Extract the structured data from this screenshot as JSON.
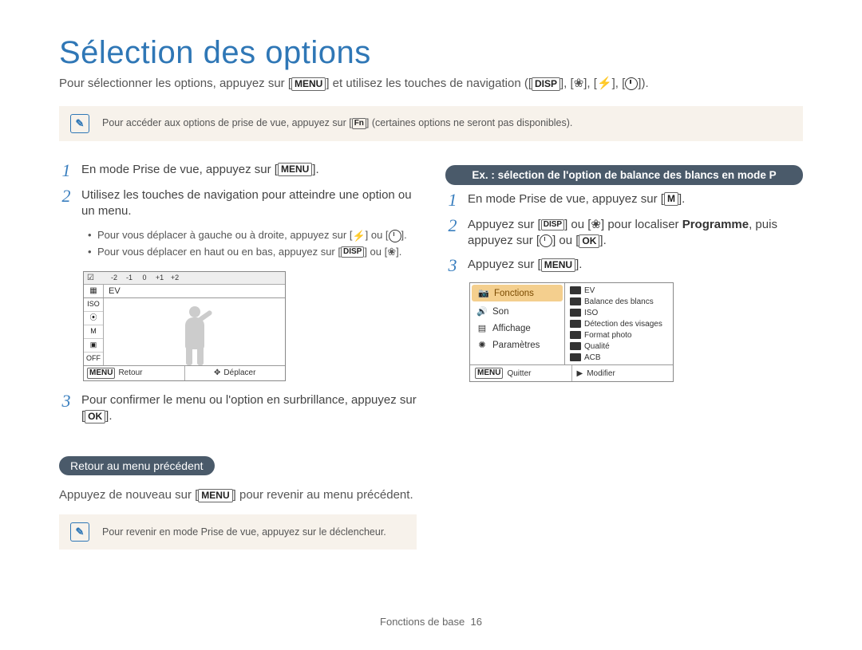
{
  "title": "Sélection des options",
  "intro_before": "Pour sélectionner les options, appuyez sur [",
  "intro_menu": "MENU",
  "intro_mid": "] et utilisez les touches de navigation ([",
  "intro_disp": "DISP",
  "intro_end": "]).",
  "nav_glyph_macro": "❀",
  "nav_glyph_flash": "⚡",
  "note1_before": "Pour accéder aux options de prise de vue, appuyez sur [",
  "note1_fn": "Fn",
  "note1_after": "] (certaines options ne seront pas disponibles).",
  "left": {
    "s1_before": "En mode Prise de vue, appuyez sur [",
    "s1_menu": "MENU",
    "s1_after": "].",
    "s2": "Utilisez les touches de navigation pour atteindre une option ou un menu.",
    "b1_before": "Pour vous déplacer à gauche ou à droite, appuyez sur [",
    "b1_or": "] ou [",
    "b1_after": "].",
    "b2_before": "Pour vous déplacer en haut ou en bas, appuyez sur [",
    "b2_disp": "DISP",
    "b2_or": "] ou [",
    "b2_after": "].",
    "lcd": {
      "scale": [
        "-2",
        "-1",
        "0",
        "+1",
        "+2"
      ],
      "ev": "EV",
      "side": [
        "ISO",
        "⦿",
        "M",
        "▣",
        "OFF"
      ],
      "back_key": "MENU",
      "back": "Retour",
      "move": "Déplacer"
    },
    "s3_before": "Pour confirmer le menu ou l'option en surbrillance, appuyez sur [",
    "s3_ok": "OK",
    "s3_after": "].",
    "returnhead": "Retour au menu précédent",
    "return_before": "Appuyez de nouveau sur [",
    "return_menu": "MENU",
    "return_after": "] pour revenir au menu précédent.",
    "note2": "Pour revenir en mode Prise de vue, appuyez sur le déclencheur."
  },
  "right": {
    "exhead": "Ex. : sélection de l'option de balance des blancs en mode P",
    "s1_before": "En mode Prise de vue, appuyez sur [",
    "s1_m": "M",
    "s1_after": "].",
    "s2_a": "Appuyez sur [",
    "s2_disp": "DISP",
    "s2_or1": "] ou [",
    "s2_b": "] pour localiser ",
    "s2_prog": "Programme",
    "s2_c": ", puis appuyez sur [",
    "s2_or2": "] ou [",
    "s2_ok": "OK",
    "s2_after": "].",
    "s3_before": "Appuyez sur [",
    "s3_menu": "MENU",
    "s3_after": "].",
    "lcd": {
      "left": [
        {
          "icon": "📷",
          "label": "Fonctions",
          "sel": true
        },
        {
          "icon": "🔊",
          "label": "Son"
        },
        {
          "icon": "▤",
          "label": "Affichage"
        },
        {
          "icon": "✺",
          "label": "Paramètres"
        }
      ],
      "right": [
        "EV",
        "Balance des blancs",
        "ISO",
        "Détection des visages",
        "Format photo",
        "Qualité",
        "ACB"
      ],
      "quit_key": "MENU",
      "quit": "Quitter",
      "mod_icon": "▶",
      "mod": "Modifier"
    }
  },
  "footer_label": "Fonctions de base",
  "footer_page": "16"
}
